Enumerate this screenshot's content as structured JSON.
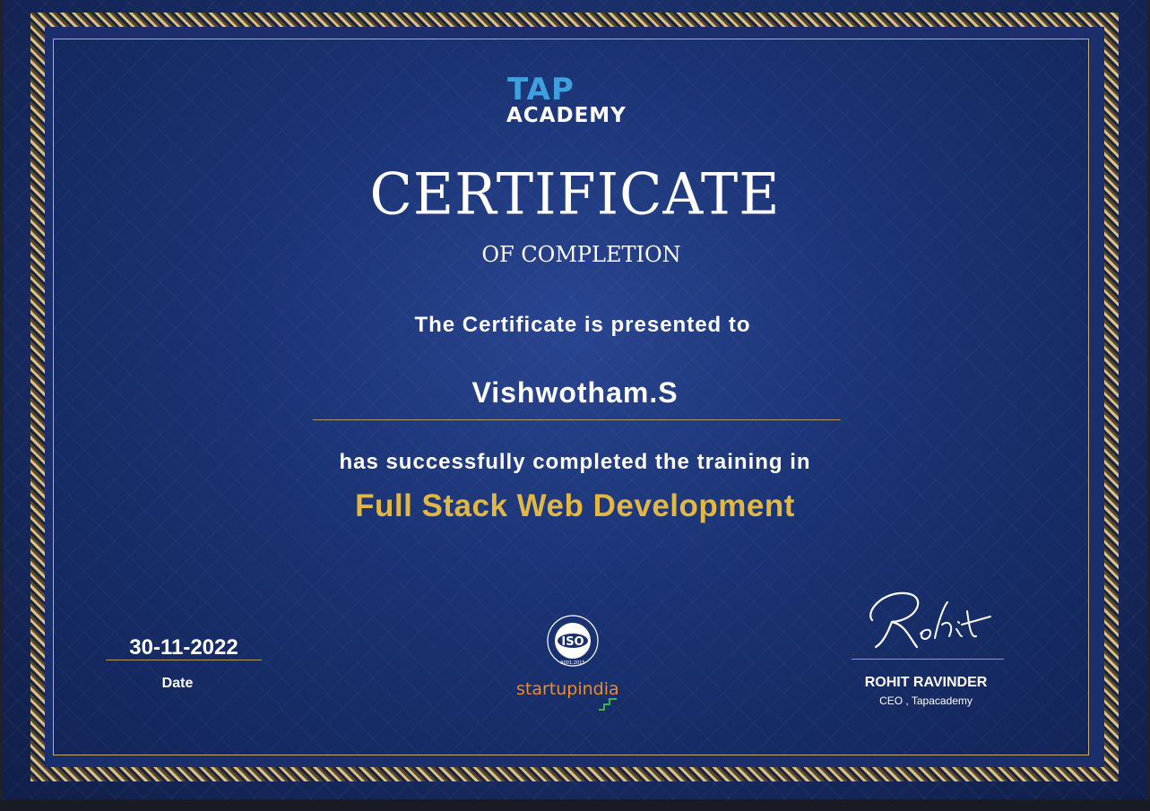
{
  "logo": {
    "line1": "TAP",
    "line2": "ACADEMY"
  },
  "title": {
    "main": "CERTIFICATE",
    "sub": "OF COMPLETION"
  },
  "presented_text": "The Certificate is presented to",
  "recipient_name": "Vishwotham.S",
  "completed_text": "has successfully completed the training in",
  "course_name": "Full Stack Web Development",
  "date": {
    "value": "30-11-2022",
    "label": "Date"
  },
  "badges": {
    "iso_label": "ISO",
    "iso_standard": "9001:2015",
    "startup_label": "startupindia"
  },
  "signatory": {
    "signature_text": "Rohit",
    "name": "ROHIT RAVINDER",
    "title": "CEO , Tapacademy"
  },
  "colors": {
    "background": "#1a2f6b",
    "gold_border": "#c9ad6e",
    "course_gold": "#e2b744",
    "logo_blue": "#3fa0e0",
    "startup_orange": "#f08a2a"
  }
}
